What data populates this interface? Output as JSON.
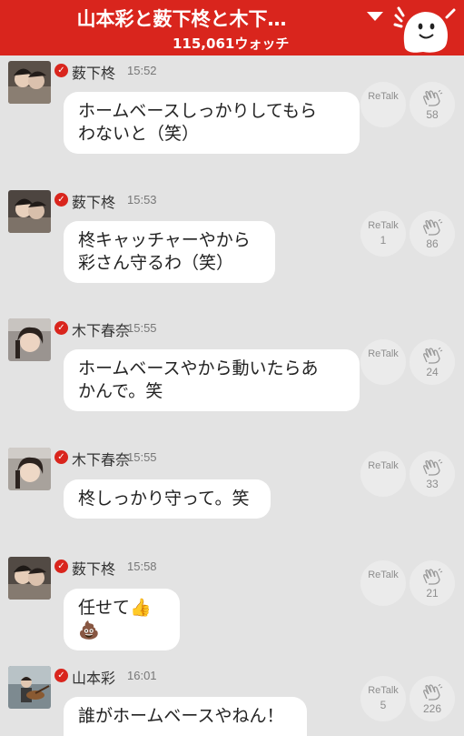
{
  "header": {
    "title": "山本彩と薮下柊と木下…",
    "watch_count": "115,061ウォッチ"
  },
  "messages": [
    {
      "sender": "薮下柊",
      "time": "15:52",
      "text_lines": [
        "ホームベースしっかりしてもら",
        "わないと（笑）"
      ],
      "retalk_label": "ReTalk",
      "retalk_count": "",
      "clap_count": "58"
    },
    {
      "sender": "薮下柊",
      "time": "15:53",
      "text_lines": [
        "柊キャッチャーやから",
        "彩さん守るわ（笑）"
      ],
      "retalk_label": "ReTalk",
      "retalk_count": "1",
      "clap_count": "86"
    },
    {
      "sender": "木下春奈",
      "time": "15:55",
      "text_lines": [
        "ホームベースやから動いたらあ",
        "かんで。笑"
      ],
      "retalk_label": "ReTalk",
      "retalk_count": "",
      "clap_count": "24"
    },
    {
      "sender": "木下春奈",
      "time": "15:55",
      "text_lines": [
        "柊しっかり守って。笑"
      ],
      "retalk_label": "ReTalk",
      "retalk_count": "",
      "clap_count": "33"
    },
    {
      "sender": "薮下柊",
      "time": "15:58",
      "text_lines": [
        "任せて👍💩"
      ],
      "retalk_label": "ReTalk",
      "retalk_count": "",
      "clap_count": "21"
    },
    {
      "sender": "山本彩",
      "time": "16:01",
      "text_lines": [
        "誰がホームベースやねん！"
      ],
      "retalk_label": "ReTalk",
      "retalk_count": "5",
      "clap_count": "226"
    }
  ],
  "colors": {
    "accent": "#d9251d",
    "background": "#e3e3e3",
    "bubble": "#ffffff"
  },
  "icons": [
    "chevron-down-icon",
    "mascot-icon",
    "verified-icon",
    "clap-icon"
  ]
}
